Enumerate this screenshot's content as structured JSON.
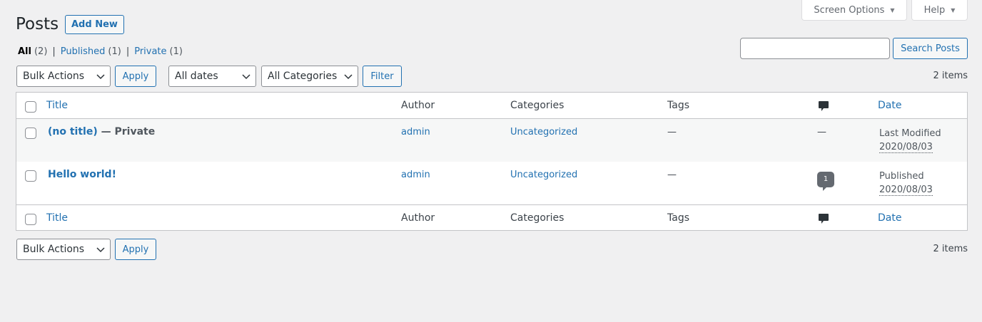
{
  "header": {
    "title": "Posts",
    "add_new": "Add New"
  },
  "screen_meta": {
    "screen_options": "Screen Options",
    "help": "Help"
  },
  "views": [
    {
      "label": "All",
      "count": "(2)"
    },
    {
      "label": "Published",
      "count": "(1)"
    },
    {
      "label": "Private",
      "count": "(1)"
    }
  ],
  "search": {
    "button": "Search Posts",
    "value": ""
  },
  "tablenav_top": {
    "bulk_actions": "Bulk Actions",
    "apply": "Apply",
    "dates": "All dates",
    "categories": "All Categories",
    "filter": "Filter",
    "items": "2 items"
  },
  "tablenav_bottom": {
    "bulk_actions": "Bulk Actions",
    "apply": "Apply",
    "items": "2 items"
  },
  "columns": {
    "title": "Title",
    "author": "Author",
    "categories": "Categories",
    "tags": "Tags",
    "comments_icon": "comment-icon",
    "date": "Date"
  },
  "rows": [
    {
      "title": "(no title)",
      "state": " — Private",
      "author": "admin",
      "category": "Uncategorized",
      "tags": "—",
      "comments": "—",
      "date_status": "Last Modified",
      "date": "2020/08/03"
    },
    {
      "title": "Hello world!",
      "state": "",
      "author": "admin",
      "category": "Uncategorized",
      "tags": "—",
      "comments": "1",
      "date_status": "Published",
      "date": "2020/08/03"
    }
  ],
  "colors": {
    "link": "#2271b1",
    "background": "#f0f0f1"
  }
}
